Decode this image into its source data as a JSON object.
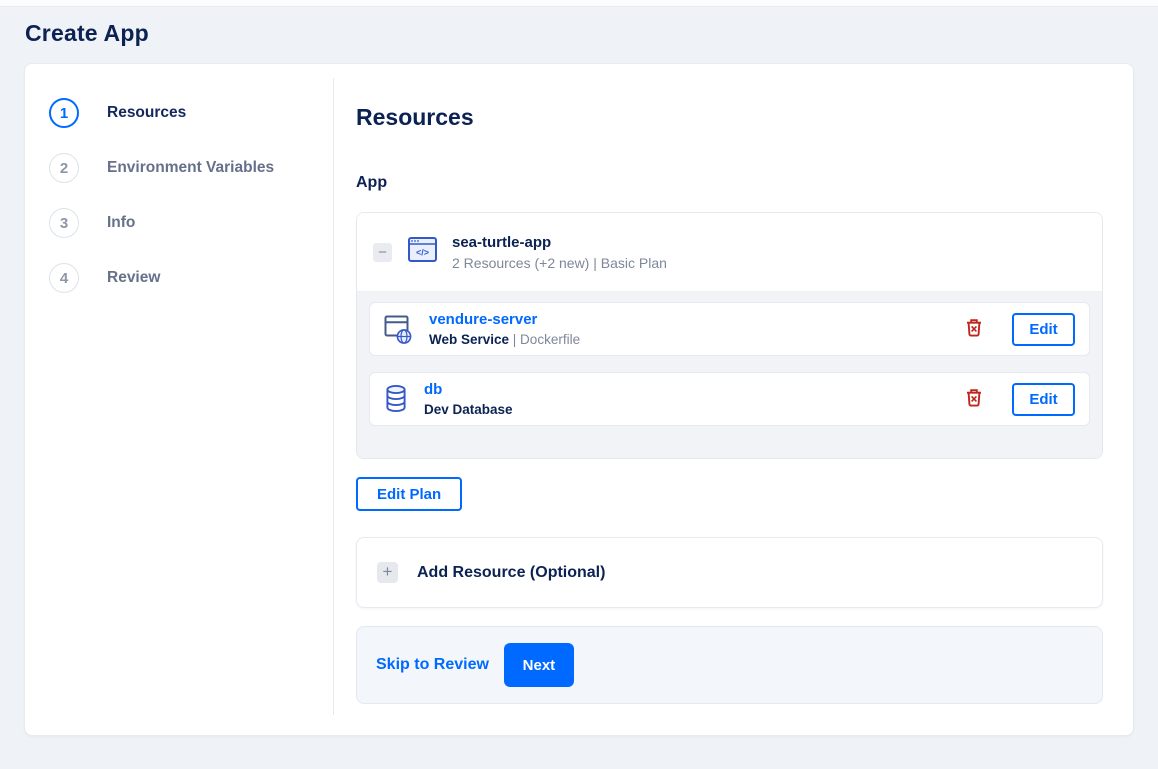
{
  "page": {
    "title": "Create App"
  },
  "stepper": {
    "steps": [
      {
        "number": "1",
        "label": "Resources",
        "active": true
      },
      {
        "number": "2",
        "label": "Environment Variables",
        "active": false
      },
      {
        "number": "3",
        "label": "Info",
        "active": false
      },
      {
        "number": "4",
        "label": "Review",
        "active": false
      }
    ]
  },
  "main": {
    "heading": "Resources",
    "section_label": "App",
    "app_card": {
      "name": "sea-turtle-app",
      "subtitle": "2 Resources (+2 new) | Basic Plan",
      "resources": [
        {
          "name": "vendure-server",
          "type": "Web Service",
          "source": " | Dockerfile",
          "edit_label": "Edit",
          "icon": "web-service-icon"
        },
        {
          "name": "db",
          "type": "Dev Database",
          "source": "",
          "edit_label": "Edit",
          "icon": "database-icon"
        }
      ]
    },
    "edit_plan_label": "Edit Plan",
    "add_resource_label": "Add Resource (Optional)",
    "footer": {
      "skip_label": "Skip to Review",
      "next_label": "Next"
    }
  },
  "icons": {
    "collapse_glyph": "−",
    "add_glyph": "+"
  },
  "colors": {
    "accent": "#0069ff",
    "heading": "#0b2253",
    "muted_text": "#7e8899",
    "danger": "#c0261d",
    "page_background": "#eff2f6"
  }
}
